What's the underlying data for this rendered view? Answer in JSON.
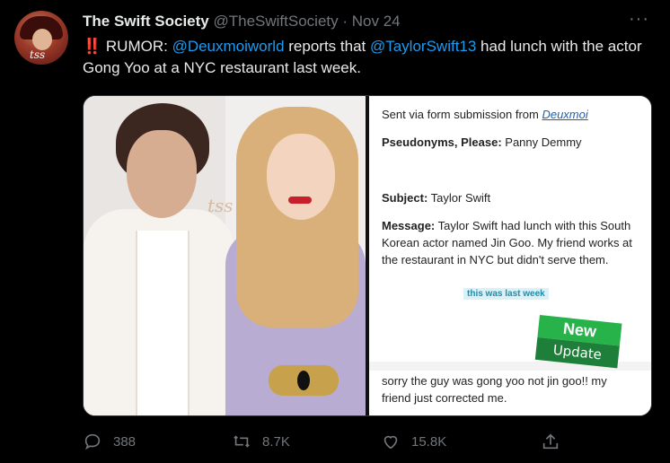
{
  "tweet": {
    "author": "The Swift Society",
    "handle": "@TheSwiftSociety",
    "separator": "·",
    "date": "Nov 24",
    "more": "···",
    "avatar_text": "tss",
    "text": {
      "emoji": "‼️",
      "part1": " RUMOR: ",
      "mention1": "@Deuxmoiworld",
      "part2": " reports that ",
      "mention2": "@TaylorSwift13",
      "part3": " had lunch with the actor Gong Yoo at a NYC restaurant last week."
    }
  },
  "media": {
    "photo_watermark": "tss",
    "submission": {
      "sent_label": "Sent via form submission from ",
      "sent_link": "Deuxmoi",
      "pseudonyms_label": "Pseudonyms, Please:",
      "pseudonyms_value": " Panny Demmy",
      "subject_label": "Subject:",
      "subject_value": " Taylor Swift",
      "message_label": "Message:",
      "message_line1": " Taylor Swift had lunch with this South",
      "message_line2": "Korean actor named Jin Goo. My friend works at",
      "message_line3": "the restaurant in NYC but didn't serve them.",
      "chip": "this was last week",
      "badge_top": "New",
      "badge_bottom": "Update",
      "update_line1": "sorry the guy was gong yoo not jin goo!! my",
      "update_line2": "friend just corrected me."
    }
  },
  "actions": {
    "replies": "388",
    "retweets": "8.7K",
    "likes": "15.8K"
  },
  "colors": {
    "background": "#000000",
    "link": "#1d9bf0",
    "muted": "#71767b",
    "alert": "#f4212e"
  }
}
